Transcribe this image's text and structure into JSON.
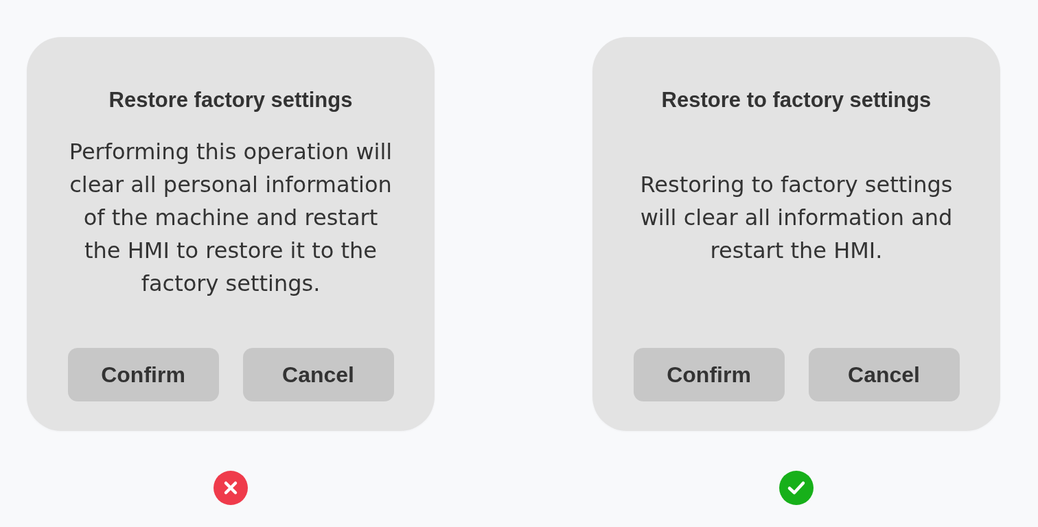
{
  "examples": [
    {
      "kind": "wrong",
      "dialog": {
        "title": "Restore factory settings",
        "message": "Performing this operation will clear all personal information of the machine and restart the HMI to restore it to the factory settings.",
        "buttons": [
          "Confirm",
          "Cancel"
        ]
      }
    },
    {
      "kind": "right",
      "dialog": {
        "title": "Restore to factory settings",
        "message": "Restoring to factory settings will clear all information and restart the HMI.",
        "buttons": [
          "Confirm",
          "Cancel"
        ]
      }
    }
  ]
}
